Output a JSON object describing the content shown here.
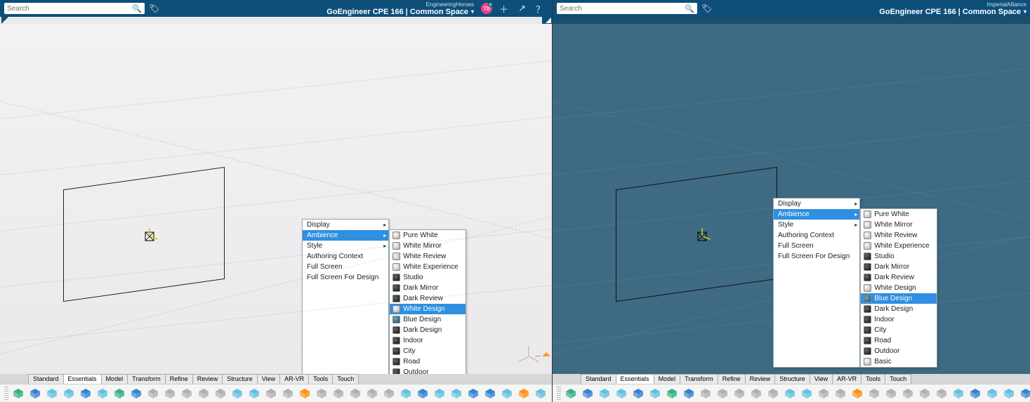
{
  "shared": {
    "search_placeholder": "Search",
    "top_subtitle_left": "EngineeringHeroes",
    "top_subtitle_right": "ImperialAlliance",
    "top_title": "GoEngineer CPE 166 | Common Space",
    "avatar_initials": "TB",
    "tabs": [
      "Standard",
      "Essentials",
      "Model",
      "Transform",
      "Refine",
      "Review",
      "Structure",
      "View",
      "AR-VR",
      "Tools",
      "Touch"
    ],
    "active_tab": "Essentials",
    "ctx_main": [
      {
        "label": "Display",
        "has_sub": true,
        "sel": false
      },
      {
        "label": "Ambience",
        "has_sub": true,
        "sel": true
      },
      {
        "label": "Style",
        "has_sub": true,
        "sel": false
      },
      {
        "label": "Authoring Context",
        "has_sub": false,
        "sel": false
      },
      {
        "label": "Full Screen",
        "has_sub": false,
        "sel": false
      },
      {
        "label": "Full Screen For Design",
        "has_sub": false,
        "sel": false
      }
    ],
    "ambience_items": [
      {
        "label": "Pure White",
        "cls": ""
      },
      {
        "label": "White Mirror",
        "cls": ""
      },
      {
        "label": "White Review",
        "cls": ""
      },
      {
        "label": "White Experience",
        "cls": ""
      },
      {
        "label": "Studio",
        "cls": "dark"
      },
      {
        "label": "Dark Mirror",
        "cls": "dark"
      },
      {
        "label": "Dark Review",
        "cls": "dark"
      },
      {
        "label": "White Design",
        "cls": ""
      },
      {
        "label": "Blue Design",
        "cls": "blue"
      },
      {
        "label": "Dark Design",
        "cls": "dark"
      },
      {
        "label": "Indoor",
        "cls": "dark"
      },
      {
        "label": "City",
        "cls": "dark"
      },
      {
        "label": "Road",
        "cls": "dark"
      },
      {
        "label": "Outdoor",
        "cls": "dark"
      },
      {
        "label": "Basic",
        "cls": ""
      }
    ],
    "selected_ambience_left": "White Design",
    "selected_ambience_right": "Blue Design",
    "status_text": "..."
  }
}
